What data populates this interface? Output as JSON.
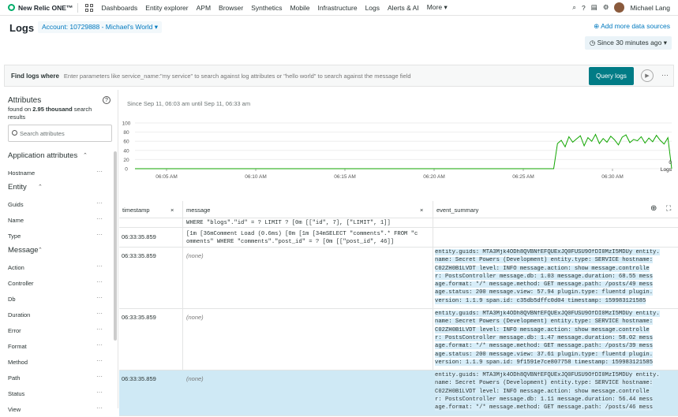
{
  "nav": {
    "brand": "New Relic ONE™",
    "items": [
      "Dashboards",
      "Entity explorer",
      "APM",
      "Browser",
      "Synthetics",
      "Mobile",
      "Infrastructure",
      "Logs",
      "Alerts & AI"
    ],
    "more": "More",
    "user": "Michael Lang"
  },
  "header": {
    "title": "Logs",
    "account": "Account: 10729888 - Michael's World",
    "add_sources": "Add more data sources",
    "time_range": "Since 30 minutes ago"
  },
  "query": {
    "label": "Find logs where",
    "placeholder": "Enter parameters like service_name:\"my service\" to search against log attributes or \"hello world\" to search against the message field",
    "button": "Query logs"
  },
  "sidebar": {
    "title": "Attributes",
    "found_prefix": "found on ",
    "found_count": "2.95 thousand",
    "found_suffix": " search results",
    "search_placeholder": "Search attributes",
    "rows": [
      {
        "kind": "header",
        "label": "Application attributes"
      },
      {
        "kind": "item",
        "label": "Hostname"
      },
      {
        "kind": "header",
        "label": "Entity"
      },
      {
        "kind": "item",
        "label": "Guids"
      },
      {
        "kind": "item",
        "label": "Name"
      },
      {
        "kind": "item",
        "label": "Type"
      },
      {
        "kind": "header",
        "label": "Message"
      },
      {
        "kind": "item",
        "label": "Action"
      },
      {
        "kind": "item",
        "label": "Controller"
      },
      {
        "kind": "item",
        "label": "Db"
      },
      {
        "kind": "item",
        "label": "Duration"
      },
      {
        "kind": "item",
        "label": "Error"
      },
      {
        "kind": "item",
        "label": "Format"
      },
      {
        "kind": "item",
        "label": "Method"
      },
      {
        "kind": "item",
        "label": "Path"
      },
      {
        "kind": "item",
        "label": "Status"
      },
      {
        "kind": "item",
        "label": "View"
      }
    ]
  },
  "main": {
    "range_text": "Since Sep 11, 06:03 am until Sep 11, 06:33 am"
  },
  "chart_data": {
    "type": "line",
    "yticks": [
      0,
      20,
      40,
      60,
      80,
      100
    ],
    "ylim": [
      0,
      100
    ],
    "xticks": [
      "06:05 AM",
      "06:10 AM",
      "06:15 AM",
      "06:20 AM",
      "06:25 AM",
      "06:30 AM",
      "06:3"
    ],
    "series": [
      {
        "name": "Logs",
        "values": [
          0,
          0,
          0,
          0,
          0,
          0,
          0,
          0,
          0,
          0,
          0,
          0,
          0,
          0,
          0,
          0,
          0,
          0,
          0,
          0,
          0,
          0,
          0,
          0,
          0,
          0,
          0,
          0,
          0,
          0,
          0,
          0,
          0,
          0,
          0,
          0,
          0,
          0,
          0,
          0,
          0,
          0,
          0,
          0,
          0,
          0,
          0,
          0,
          0,
          0,
          0,
          0,
          0,
          0,
          0,
          0,
          0,
          0,
          0,
          0,
          0,
          0,
          0,
          0,
          0,
          0,
          0,
          0,
          0,
          0,
          0,
          0,
          0,
          0,
          0,
          0,
          0,
          0,
          0,
          0,
          0,
          0,
          0,
          0,
          0,
          0,
          0,
          0,
          0,
          0,
          0,
          0,
          0,
          0,
          0,
          0,
          0,
          0,
          0,
          0,
          0,
          0,
          0,
          0,
          0,
          0,
          0,
          0,
          0,
          0,
          0,
          55,
          62,
          48,
          70,
          58,
          65,
          72,
          50,
          68,
          60,
          75,
          55,
          66,
          58,
          71,
          63,
          52,
          69,
          74,
          57,
          64,
          61,
          70,
          56,
          67,
          59,
          73,
          62,
          54,
          68,
          0
        ]
      }
    ],
    "end_value": "0",
    "end_label": "Logs"
  },
  "table": {
    "columns": [
      "timestamp",
      "message",
      "event_summary"
    ],
    "partial_row": {
      "message_lines": [
        "WHERE \"blogs\".\"id\" = ? LIMIT ? [0m [[\"id\", 7], [\"LIMIT\", 1]]"
      ]
    },
    "rows": [
      {
        "timestamp": "06:33:35.859",
        "message_lines": [
          "[1m [36mComment Load (0.6ms) [0m  [1m [34mSELECT \"comments\".* FROM \"c",
          "omments\" WHERE \"comments\".\"post_id\" = ? [0m [[\"post_id\", 46]]"
        ],
        "message": "",
        "summary_lines": []
      },
      {
        "timestamp": "06:33:35.859",
        "message": "(none)",
        "message_lines": [],
        "summary_lines": [
          "entity.guids: MTA3Mjk4ODh8QVBNfEFQUExJQ0FUSU9OfDI0MzI5MDUy  entity.",
          "name: Secret Powers (Development)  entity.type: SERVICE  hostname:",
          "C02ZH0B1LVDT  level: INFO  message.action: show  message.controlle",
          "r: PostsController  message.db: 1.03  message.duration: 68.55  mess",
          "age.format: */*  message.method: GET  message.path: /posts/49  mess",
          "age.status: 200  message.view: 57.94  plugin.type: fluentd  plugin.",
          "version: 1.1.9  span.id: c35db5dffc0d04  timestamp: 159983121585"
        ]
      },
      {
        "timestamp": "06:33:35.859",
        "message": "(none)",
        "message_lines": [],
        "summary_lines": [
          "entity.guids: MTA3Mjk4ODh8QVBNfEFQUExJQ0FUSU9OfDI0MzI5MDUy  entity.",
          "name: Secret Powers (Development)  entity.type: SERVICE  hostname:",
          "C02ZH0B1LVDT  level: INFO  message.action: show  message.controlle",
          "r: PostsController  message.db: 1.47  message.duration: 58.02  mess",
          "age.format: */*  message.method: GET  message.path: /posts/39  mess",
          "age.status: 200  message.view: 37.61  plugin.type: fluentd  plugin.",
          "version: 1.1.9  span.id: 9f1591e7ce807758  timestamp: 159983121585"
        ]
      },
      {
        "timestamp": "06:33:35.859",
        "message": "(none)",
        "message_lines": [],
        "selected": true,
        "summary_lines": [
          "entity.guids: MTA3Mjk4ODh8QVBNfEFQUExJQ0FUSU9OfDI0MzI5MDUy  entity.",
          "name: Secret Powers (Development)  entity.type: SERVICE  hostname:",
          "C02ZH0B1LVDT  level: INFO  message.action: show  message.controlle",
          "r: PostsController  message.db: 1.11  message.duration: 56.44  mess",
          "age.format: */*  message.method: GET  message.path: /posts/46  mess"
        ]
      }
    ]
  }
}
